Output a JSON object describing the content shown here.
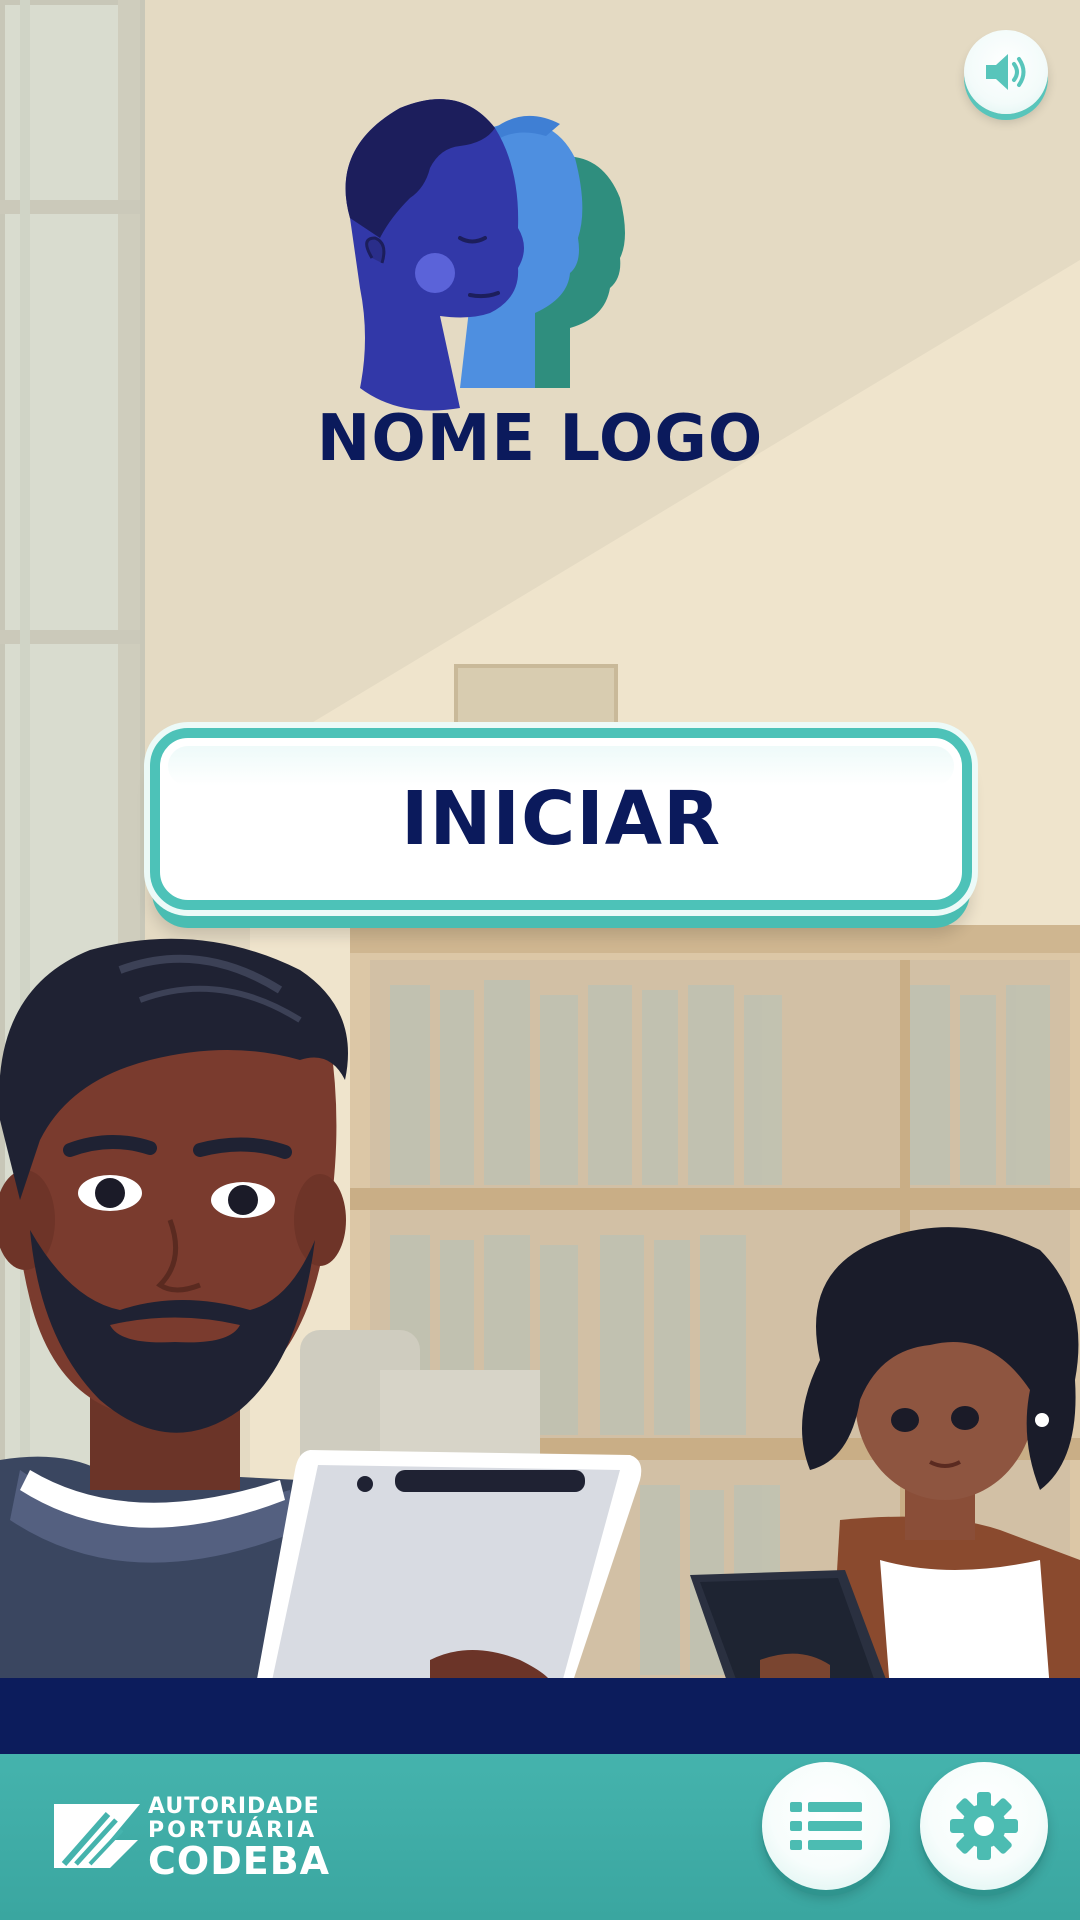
{
  "logo": {
    "name": "NOME LOGO",
    "icon": "profile-heads-logo"
  },
  "start_button": {
    "label": "INICIAR"
  },
  "sound_button": {
    "icon": "speaker-icon"
  },
  "footer": {
    "brand": {
      "line1": "AUTORIDADE",
      "line2": "PORTUÁRIA",
      "line3": "CODEBA"
    },
    "menu_button": {
      "icon": "list-icon"
    },
    "settings_button": {
      "icon": "gear-icon"
    }
  },
  "colors": {
    "navy": "#0c1c5c",
    "teal": "#45b3ad",
    "accent": "#4dc2b8",
    "background": "#e9dfc9"
  }
}
